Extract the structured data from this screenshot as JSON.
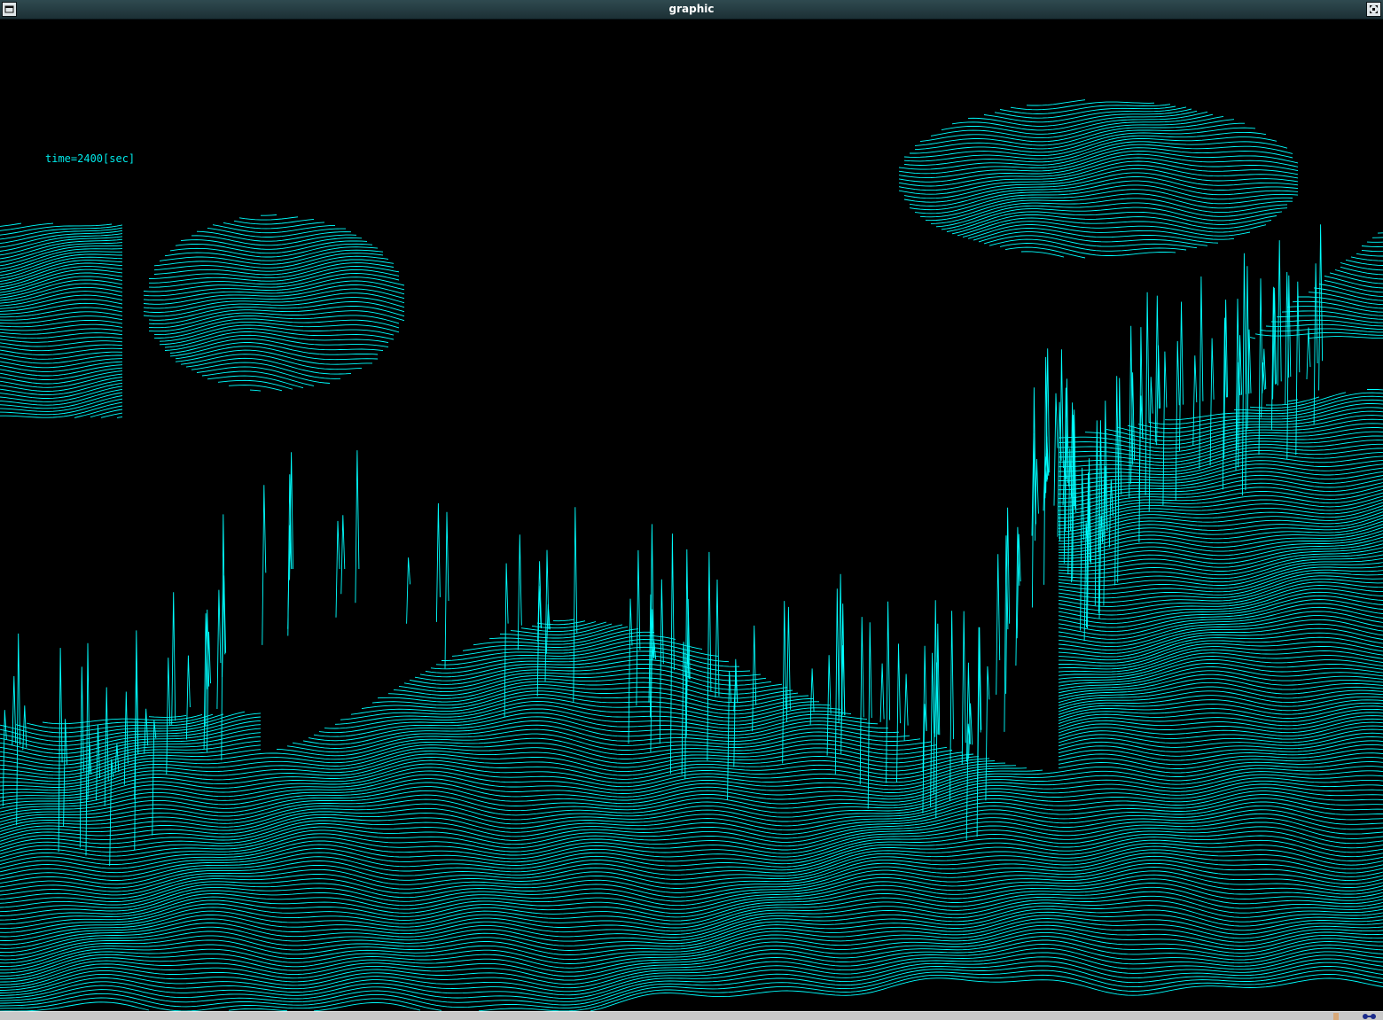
{
  "window": {
    "title": "graphic"
  },
  "plot": {
    "time_label": "time=2400[sec]",
    "line_color": "#00ffff",
    "background_color": "#000000",
    "description": ""
  },
  "icons": {
    "menu": "window-menu-icon",
    "maximize": "maximize-icon",
    "tray": "tray-network-icon"
  }
}
